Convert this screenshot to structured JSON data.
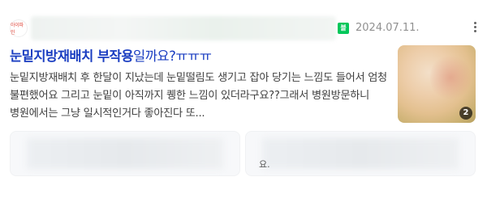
{
  "result": {
    "avatar_text": "아이파인",
    "source_badge": "블로그",
    "date": "2024.07.11.",
    "title_highlight": "눈밑지방재배치 부작용",
    "title_rest": "일까요?ㅠㅠㅠ",
    "snippet": "눈밑지방재배치 후 한달이 지났는데 눈밑떨림도 생기고 잡아 당기는 느낌도 들어서 엄청 불편했어요 그리고 눈밑이 아직까지 퀭한 느낌이 있더라구요??그래서 병원방문하니 병원에서는 그냥 일시적인거다 좋아진다 또...",
    "image_count": "2"
  },
  "related": [
    {
      "text": ""
    },
    {
      "text": "요."
    }
  ],
  "colors": {
    "title": "#1a3dc1",
    "badge": "#03c75a"
  }
}
